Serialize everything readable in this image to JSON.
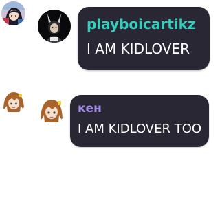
{
  "messages": [
    {
      "username": "playboicartikz",
      "text": "I AM KIDLOVER",
      "username_color": "#34d0bd",
      "avatar_small": "anime-girl-avatar",
      "avatar_large": "dark-figure-avatar"
    },
    {
      "username": "кен",
      "text": "I AM KIDLOVER TOO",
      "username_color": "#a58be8",
      "avatar_small": "anime-brown-hair-avatar",
      "avatar_large": "anime-brown-hair-avatar"
    }
  ],
  "colors": {
    "bubble_background": "#2a2735",
    "message_text": "#ffffff",
    "page_background": "#ffffff"
  }
}
